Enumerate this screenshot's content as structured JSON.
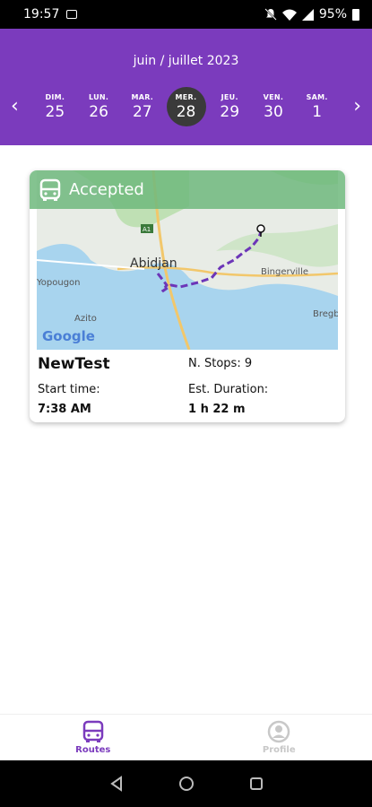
{
  "status_bar": {
    "time": "19:57",
    "battery": "95%"
  },
  "header": {
    "month": "juin / juillet 2023",
    "days": [
      {
        "name": "DIM.",
        "num": "25"
      },
      {
        "name": "LUN.",
        "num": "26"
      },
      {
        "name": "MAR.",
        "num": "27"
      },
      {
        "name": "MER.",
        "num": "28",
        "selected": true
      },
      {
        "name": "JEU.",
        "num": "29"
      },
      {
        "name": "VEN.",
        "num": "30"
      },
      {
        "name": "SAM.",
        "num": "1"
      }
    ]
  },
  "route_card": {
    "status": "Accepted",
    "name": "NewTest",
    "stops_label": "N. Stops: 9",
    "start_label": "Start time:",
    "start_value": "7:38 AM",
    "duration_label": "Est. Duration:",
    "duration_value": "1 h 22 m",
    "map": {
      "city_label": "Abidjan",
      "place_labels": [
        "Bingerville",
        "Yopougon",
        "Azito",
        "Bregbo",
        "A1"
      ],
      "attribution": "Google"
    }
  },
  "tabs": [
    {
      "label": "Routes",
      "icon": "bus-icon",
      "active": true
    },
    {
      "label": "Profile",
      "icon": "profile-icon",
      "active": false
    }
  ],
  "colors": {
    "primary": "#7b3bbd",
    "accepted": "#6eb97d",
    "selected_day": "#3a3a3a"
  }
}
